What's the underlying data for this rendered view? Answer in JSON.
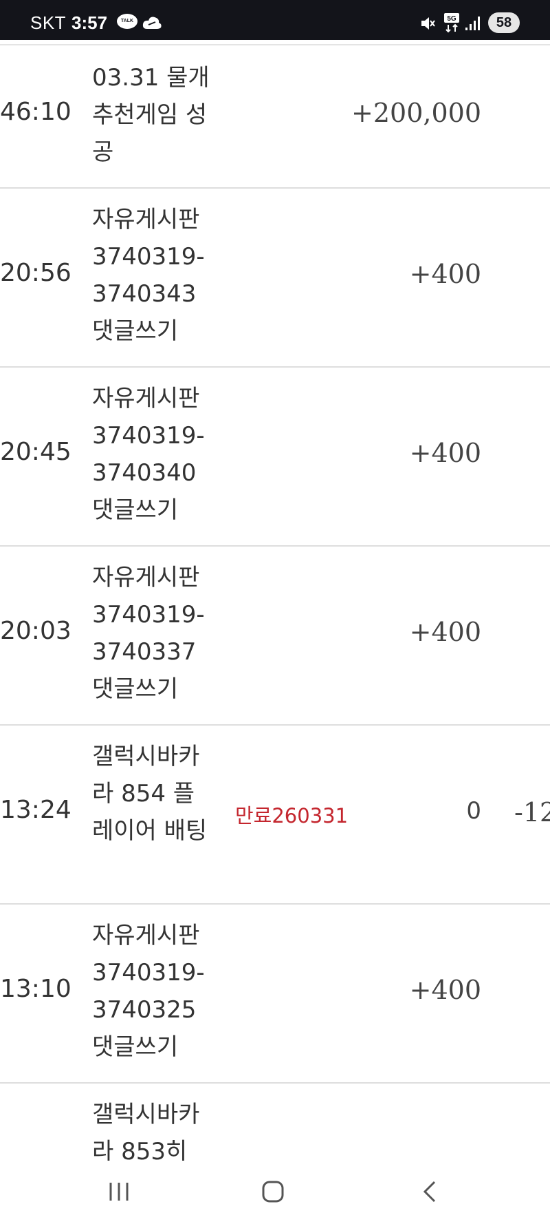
{
  "status_bar": {
    "carrier": "SKT",
    "time": "3:57",
    "talk_label": "TALK",
    "network": "5G",
    "battery": "58"
  },
  "rows": [
    {
      "time": "46:10",
      "desc": "03.31 물개 추천게임 성공",
      "amount": "+200,000"
    },
    {
      "time": "20:56",
      "desc": "자유게시판 3740319-3740343 댓글쓰기",
      "amount": "+400"
    },
    {
      "time": "20:45",
      "desc": "자유게시판 3740319-3740340 댓글쓰기",
      "amount": "+400"
    },
    {
      "time": "20:03",
      "desc": "자유게시판 3740319-3740337 댓글쓰기",
      "amount": "+400"
    },
    {
      "time": "13:24",
      "desc": "갤럭시바카라 854 플레이어 배팅",
      "note": "만료260331",
      "amount": "0",
      "extra": "-12"
    },
    {
      "time": "13:10",
      "desc": "자유게시판 3740319-3740325 댓글쓰기",
      "amount": "+400"
    },
    {
      "time": "",
      "desc": "갤럭시바카라 853히",
      "amount": ""
    }
  ],
  "colors": {
    "status_bar_bg": "#13141a",
    "expired_note": "#c4262e",
    "divider": "#dedede"
  },
  "nav": {
    "recent_icon": "recent-apps-icon",
    "home_icon": "home-icon",
    "back_icon": "back-icon"
  }
}
